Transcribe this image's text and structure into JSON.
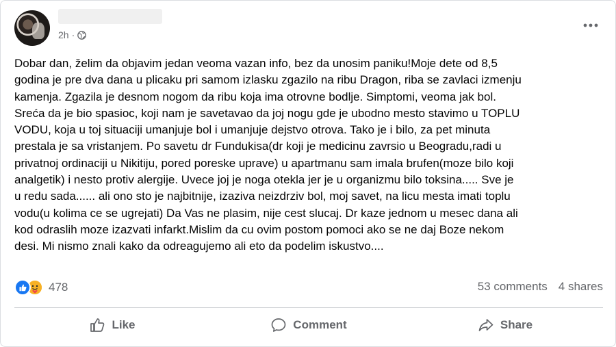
{
  "post": {
    "time": "2h",
    "separator": "·",
    "text": "Dobar dan, želim da objavim jedan veoma vazan info, bez da unosim paniku!Moje dete od 8,5\ngodina je pre dva dana u plicaku pri samom izlasku zgazilo na ribu Dragon, riba se zavlaci izmenju\nkamenja. Zgazila je desnom nogom da ribu koja ima otrovne bodlje. Simptomi, veoma jak bol.\nSreća da je bio spasioc, koji nam je savetavao da joj nogu gde je ubodno mesto stavimo u TOPLU\nVODU, koja u toj situaciji umanjuje bol i umanjuje dejstvo otrova. Tako je i bilo, za pet minuta\nprestala je sa vristanjem. Po savetu dr Fundukisa(dr koji je medicinu zavrsio u Beogradu,radi u\nprivatnoj ordinaciji u Nikitiju, pored poreske uprave) u apartmanu sam imala brufen(moze bilo koji\nanalgetik) i nesto protiv alergije. Uvece joj je noga otekla jer je u organizmu bilo toksina..... Sve je\nu redu sada...... ali ono sto je najbitnije, izaziva neizdrziv bol, moj savet, na licu mesta imati toplu\nvodu(u kolima ce se ugrejati) Da Vas ne plasim, nije cest slucaj. Dr kaze jednom u mesec dana ali\nkod odraslih moze izazvati infarkt.Mislim da cu ovim postom pomoci ako se ne daj Boze nekom\ndesi. Mi nismo znali kako da odreagujemo ali eto da podelim iskustvo....",
    "reactions_count": "478",
    "comments": "53 comments",
    "shares": "4 shares"
  },
  "actions": {
    "like": "Like",
    "comment": "Comment",
    "share": "Share"
  },
  "icons": {
    "more": "more-options-icon",
    "privacy": "globe-icon",
    "reactions": [
      "like-reaction-icon",
      "care-reaction-icon"
    ]
  },
  "colors": {
    "like_blue": "#1877f2",
    "care_yellow": "#f7b125",
    "secondary_text": "#65676b"
  }
}
